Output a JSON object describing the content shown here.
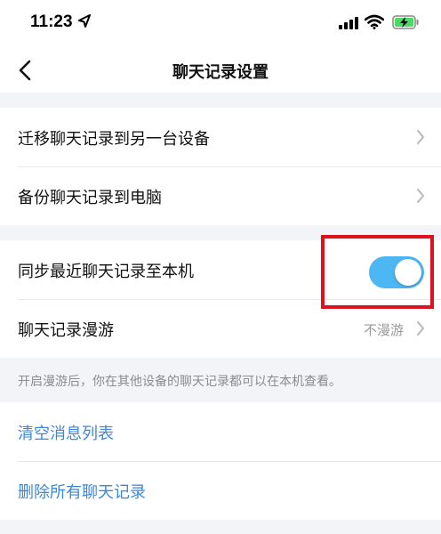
{
  "status_bar": {
    "time": "11:23",
    "icons": [
      "location-arrow-icon",
      "signal-icon",
      "wifi-icon",
      "battery-charging-icon"
    ]
  },
  "nav": {
    "title": "聊天记录设置",
    "back_icon": "chevron-left-icon"
  },
  "group1": {
    "items": [
      {
        "label": "迁移聊天记录到另一台设备",
        "icon": "chevron-right-icon"
      },
      {
        "label": "备份聊天记录到电脑",
        "icon": "chevron-right-icon"
      }
    ]
  },
  "group2": {
    "sync": {
      "label": "同步最近聊天记录至本机",
      "toggle_on": true,
      "toggle_color": "#4db7f3"
    },
    "roaming": {
      "label": "聊天记录漫游",
      "value": "不漫游",
      "icon": "chevron-right-icon"
    },
    "highlight_color": "#e0111f"
  },
  "hint": "开启漫游后，你在其他设备的聊天记录都可以在本机查看。",
  "group3": {
    "items": [
      {
        "label": "清空消息列表"
      },
      {
        "label": "删除所有聊天记录"
      }
    ],
    "link_color": "#3e87d6"
  }
}
